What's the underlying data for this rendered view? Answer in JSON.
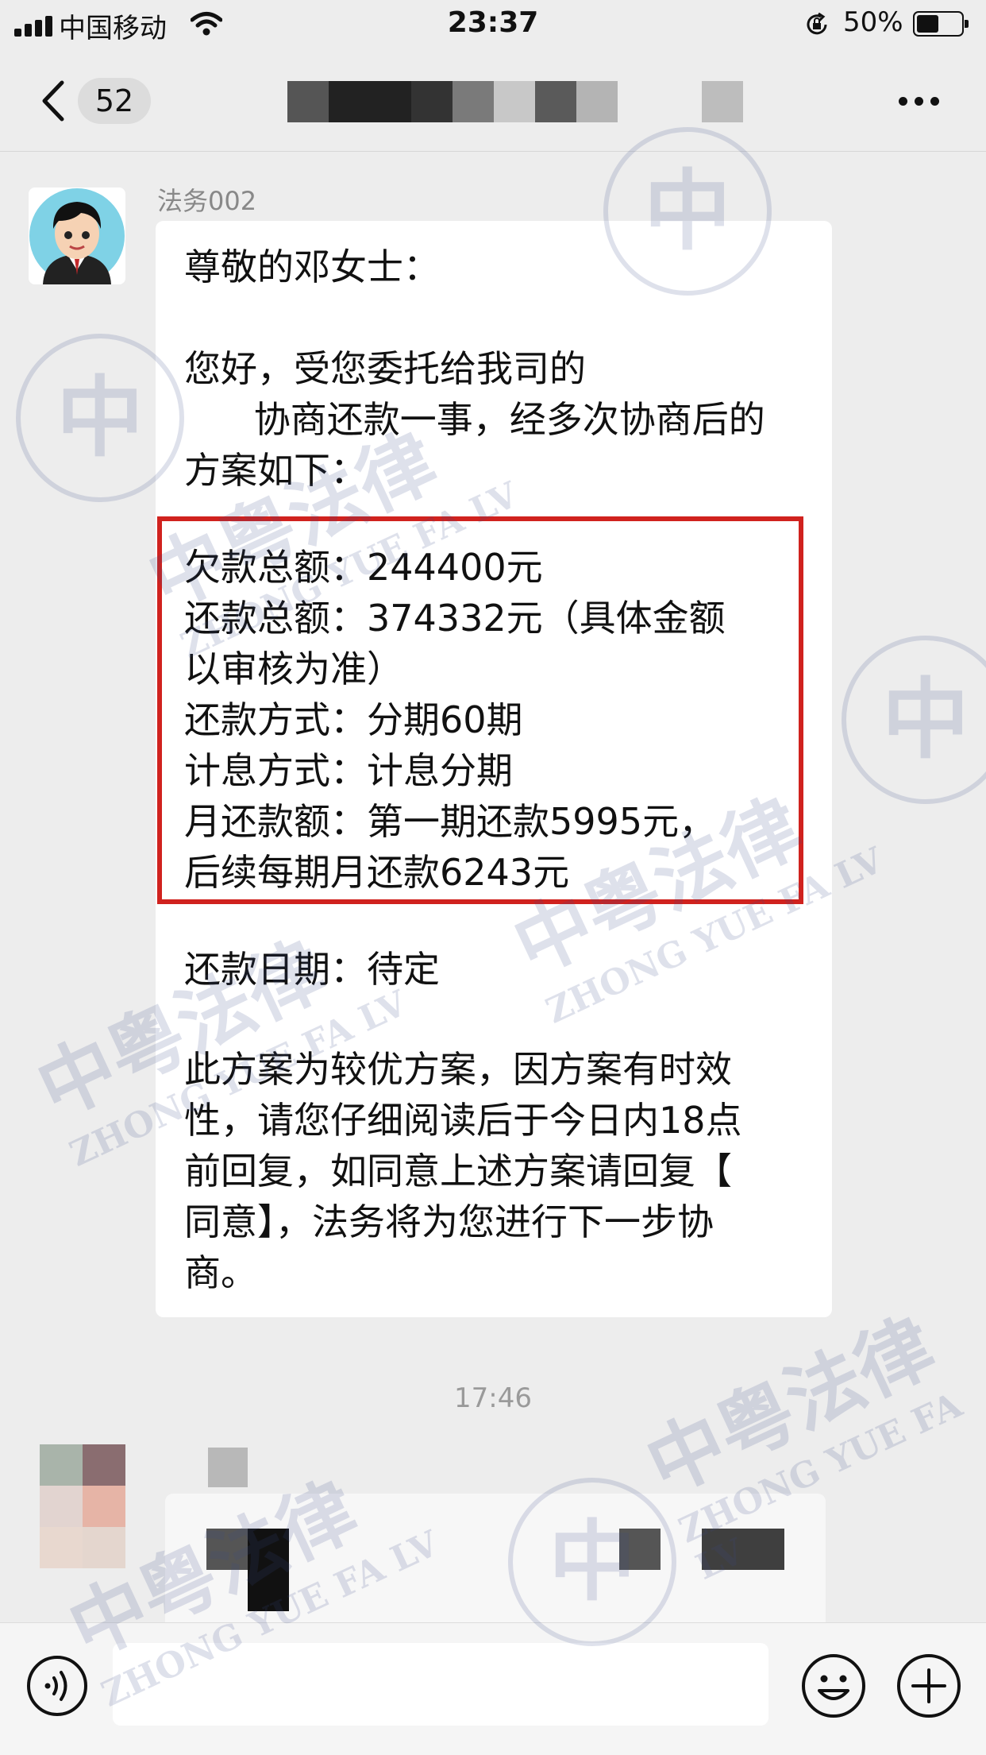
{
  "status_bar": {
    "carrier": "中国移动",
    "time": "23:37",
    "battery_percent": "50%",
    "battery_level": 0.5
  },
  "nav": {
    "unread_count": "52"
  },
  "message": {
    "sender": "法务002",
    "lines": [
      "尊敬的邓女士：",
      "",
      "您好，受您委托给我司的",
      "      协商还款一事，经多次协商后的",
      "方案如下：",
      "",
      "欠款总额：244400元",
      "还款总额：374332元（具体金额",
      "以审核为准）",
      "还款方式：分期60期",
      "计息方式：计息分期",
      "月还款额：第一期还款5995元，",
      "后续每期月还款6243元",
      "",
      "还款日期：待定",
      "",
      "此方案为较优方案，因方案有时效",
      "性，请您仔细阅读后于今日内18点",
      "前回复，如同意上述方案请回复【",
      "同意】，法务将为您进行下一步协",
      "商。"
    ]
  },
  "timestamp": "17:46",
  "watermark": {
    "chinese": "中粤法律",
    "pinyin": "ZHONG YUE FA LV",
    "seal_char": "中"
  },
  "colors": {
    "highlight_border": "#d0221e",
    "background": "#ededed",
    "bubble": "#ffffff"
  },
  "icons": [
    "signal-icon",
    "wifi-icon",
    "orientation-lock-icon",
    "battery-icon",
    "back-chevron-icon",
    "more-icon",
    "voice-icon",
    "emoji-icon",
    "plus-icon"
  ]
}
